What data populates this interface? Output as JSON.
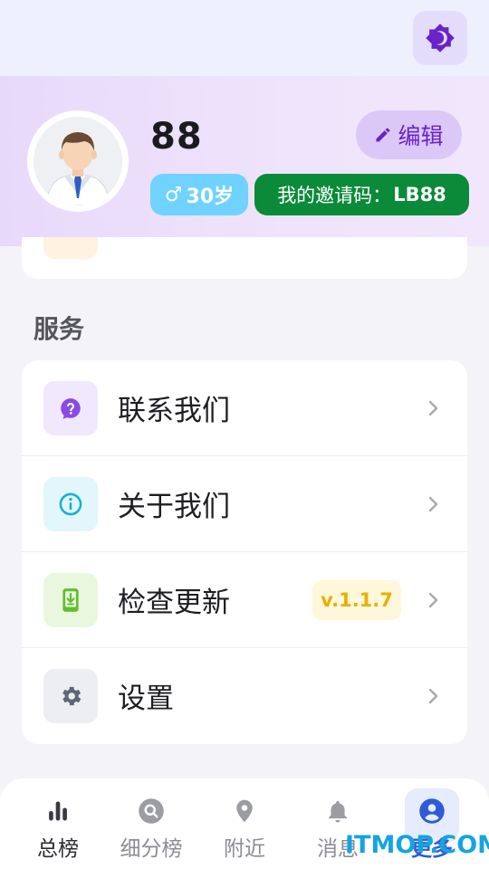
{
  "header": {
    "theme_toggle_icon": "dark-mode-icon",
    "accent": "#6a22c9"
  },
  "profile": {
    "name": "88",
    "edit_label": "编辑",
    "gender_symbol": "♂",
    "age": "30岁",
    "invite_label": "我的邀请码：",
    "invite_code": "LB88"
  },
  "services": {
    "title": "服务",
    "items": [
      {
        "label": "联系我们",
        "icon": "help-icon",
        "icon_bg": "#f0e8fd",
        "icon_color": "#8a4ae6"
      },
      {
        "label": "关于我们",
        "icon": "info-icon",
        "icon_bg": "#e2f6fb",
        "icon_color": "#17b1d3"
      },
      {
        "label": "检查更新",
        "icon": "update-icon",
        "icon_bg": "#eaf7df",
        "icon_color": "#62be2f",
        "badge": "v.1.1.7"
      },
      {
        "label": "设置",
        "icon": "gear-icon",
        "icon_bg": "#eceef1",
        "icon_color": "#5d6778"
      }
    ]
  },
  "nav": {
    "items": [
      {
        "label": "总榜",
        "icon": "bar-chart-icon"
      },
      {
        "label": "细分榜",
        "icon": "search-icon"
      },
      {
        "label": "附近",
        "icon": "location-pin-icon"
      },
      {
        "label": "消息",
        "icon": "bell-icon"
      },
      {
        "label": "更多",
        "icon": "profile-icon"
      }
    ],
    "active_index": 4
  },
  "watermark": "ITMOP.COM"
}
